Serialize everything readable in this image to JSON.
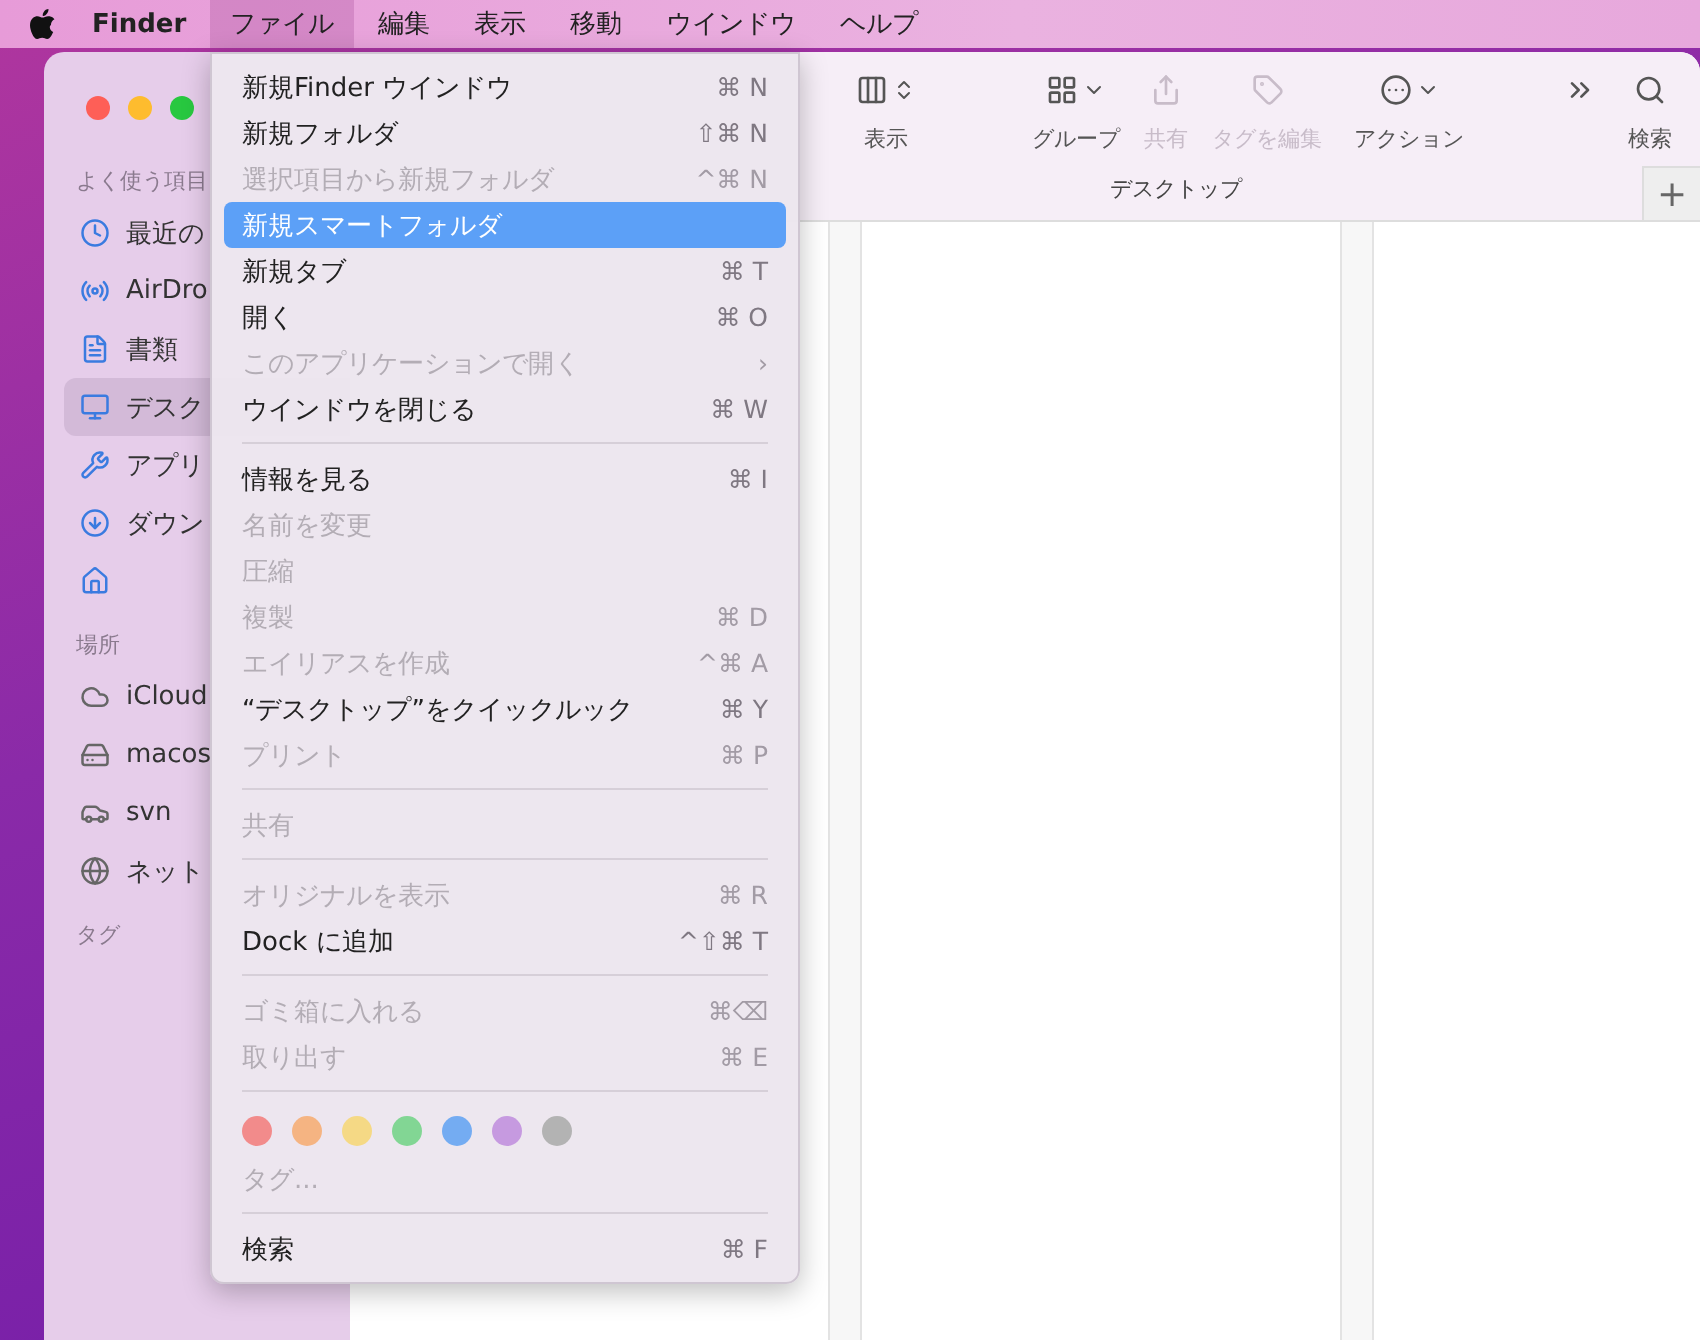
{
  "menu_bar": {
    "app_name": "Finder",
    "menus": [
      {
        "label": "ファイル",
        "selected": true
      },
      {
        "label": "編集",
        "selected": false
      },
      {
        "label": "表示",
        "selected": false
      },
      {
        "label": "移動",
        "selected": false
      },
      {
        "label": "ウインドウ",
        "selected": false
      },
      {
        "label": "ヘルプ",
        "selected": false
      }
    ]
  },
  "sidebar": {
    "sections": [
      {
        "title": "よく使う項目",
        "items": [
          {
            "label": "最近の",
            "selected": false
          },
          {
            "label": "AirDro",
            "selected": false
          },
          {
            "label": "書類",
            "selected": false
          },
          {
            "label": "デスク",
            "selected": true
          },
          {
            "label": "アプリ",
            "selected": false
          },
          {
            "label": "ダウン",
            "selected": false
          },
          {
            "selected": false
          }
        ]
      },
      {
        "title": "場所",
        "items": [
          {
            "label": "iCloud",
            "selected": false
          },
          {
            "label": "macos",
            "selected": false
          },
          {
            "label": "svn",
            "selected": false
          },
          {
            "label": "ネット",
            "selected": false
          }
        ]
      },
      {
        "title": "タグ"
      }
    ]
  },
  "toolbar": {
    "items": [
      {
        "label": "表示",
        "disabled": false
      },
      {
        "label": "グループ",
        "disabled": false
      },
      {
        "label": "共有",
        "disabled": true
      },
      {
        "label": "タグを編集",
        "disabled": true
      },
      {
        "label": "アクション",
        "disabled": false
      },
      {
        "label": "検索",
        "disabled": false
      }
    ],
    "path_title": "デスクトップ",
    "new_tab": "+"
  },
  "file_menu": {
    "items": [
      {
        "kind": "item",
        "label": "新規Finder ウインドウ",
        "shortcut": "⌘ N",
        "disabled": false,
        "selected": false
      },
      {
        "kind": "item",
        "label": "新規フォルダ",
        "shortcut": "⇧⌘ N",
        "disabled": false,
        "selected": false
      },
      {
        "kind": "item",
        "label": "選択項目から新規フォルダ",
        "shortcut": "^⌘ N",
        "disabled": true,
        "selected": false
      },
      {
        "kind": "item",
        "label": "新規スマートフォルダ",
        "disabled": false,
        "selected": true
      },
      {
        "kind": "item",
        "label": "新規タブ",
        "shortcut": "⌘ T",
        "disabled": false,
        "selected": false
      },
      {
        "kind": "item",
        "label": "開く",
        "shortcut": "⌘ O",
        "disabled": false,
        "selected": false
      },
      {
        "kind": "item",
        "label": "このアプリケーションで開く",
        "shortcut": "›",
        "disabled": true,
        "selected": false
      },
      {
        "kind": "item",
        "label": "ウインドウを閉じる",
        "shortcut": "⌘ W",
        "disabled": false,
        "selected": false
      },
      {
        "kind": "separator"
      },
      {
        "kind": "item",
        "label": "情報を見る",
        "shortcut": "⌘ I",
        "disabled": false,
        "selected": false
      },
      {
        "kind": "item",
        "label": "名前を変更",
        "disabled": true,
        "selected": false
      },
      {
        "kind": "item",
        "label": "圧縮",
        "disabled": true,
        "selected": false
      },
      {
        "kind": "item",
        "label": "複製",
        "shortcut": "⌘ D",
        "disabled": true,
        "selected": false
      },
      {
        "kind": "item",
        "label": "エイリアスを作成",
        "shortcut": "^⌘ A",
        "disabled": true,
        "selected": false
      },
      {
        "kind": "item",
        "label": "“デスクトップ”をクイックルック",
        "shortcut": "⌘ Y",
        "disabled": false,
        "selected": false
      },
      {
        "kind": "item",
        "label": "プリント",
        "shortcut": "⌘ P",
        "disabled": true,
        "selected": false
      },
      {
        "kind": "separator"
      },
      {
        "kind": "item",
        "label": "共有",
        "disabled": true,
        "selected": false
      },
      {
        "kind": "separator"
      },
      {
        "kind": "item",
        "label": "オリジナルを表示",
        "shortcut": "⌘ R",
        "disabled": true,
        "selected": false
      },
      {
        "kind": "item",
        "label": "Dock に追加",
        "shortcut": "^⇧⌘ T",
        "disabled": false,
        "selected": false
      },
      {
        "kind": "separator"
      },
      {
        "kind": "item",
        "label": "ゴミ箱に入れる",
        "shortcut": "⌘⌫",
        "disabled": true,
        "selected": false
      },
      {
        "kind": "item",
        "label": "取り出す",
        "shortcut": "⌘ E",
        "disabled": true,
        "selected": false
      },
      {
        "kind": "separator"
      },
      {
        "kind": "tags",
        "tags": [
          {
            "color": "#f28b8b"
          },
          {
            "color": "#f5b482"
          },
          {
            "color": "#f5d985"
          },
          {
            "color": "#82d694"
          },
          {
            "color": "#74acf2"
          },
          {
            "color": "#c69ae0"
          },
          {
            "color": "#b3b3b3"
          }
        ]
      },
      {
        "kind": "item",
        "label": "タグ...",
        "disabled": true,
        "selected": false
      },
      {
        "kind": "separator"
      },
      {
        "kind": "item",
        "label": "検索",
        "shortcut": "⌘ F",
        "disabled": false,
        "selected": false
      }
    ]
  }
}
